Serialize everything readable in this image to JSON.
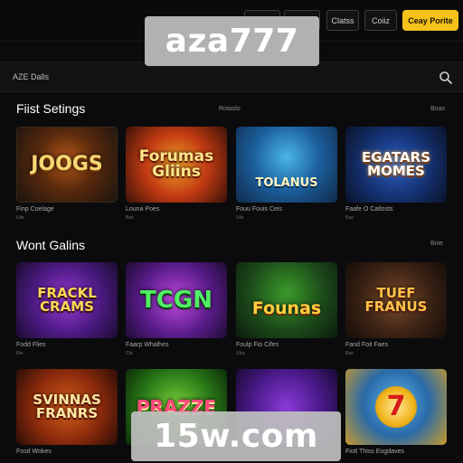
{
  "header": {
    "buttons": [
      {
        "label": ""
      },
      {
        "label": ""
      },
      {
        "label": "Clatss"
      },
      {
        "label": "Coiiz"
      },
      {
        "label": "Ceay Porite"
      }
    ]
  },
  "search": {
    "label": "AZE Dalls",
    "icon": "search-icon"
  },
  "sections": [
    {
      "title": "Fiist Setings",
      "mid_label": "Rotaslo",
      "right_label": "Boas",
      "tiles": [
        {
          "text": "JOOGS",
          "caption": "Finp Coelage",
          "subcaption": "Ulte"
        },
        {
          "text": "Forumas Gliins",
          "caption": "Louna Poes",
          "subcaption": "Bas"
        },
        {
          "text": "TOLANUS",
          "caption": "Fouu Fouis Ceis",
          "subcaption": "Ulis"
        },
        {
          "text": "EGATARS MOMES",
          "caption": "Faafe O Catlosts",
          "subcaption": "Bao"
        }
      ]
    },
    {
      "title": "Wont Galins",
      "mid_label": "",
      "right_label": "Bnie",
      "tiles": [
        {
          "text": "FRACKL CRAMS",
          "caption": "Fodd Flies",
          "subcaption": "Ilile"
        },
        {
          "text": "TCGN",
          "caption": "Faarp Whalhes",
          "subcaption": "Cte"
        },
        {
          "text": "Founas",
          "caption": "Foulp Fio Cifes",
          "subcaption": "Ulos"
        },
        {
          "text": "TUEF FRANUS",
          "caption": "Fand Foit Faes",
          "subcaption": "Bao"
        }
      ]
    },
    {
      "tiles": [
        {
          "text": "SVINNAS FRANRS",
          "caption": "Fosd Wokes",
          "subcaption": ""
        },
        {
          "text": "PRAZZE",
          "caption": "",
          "subcaption": ""
        },
        {
          "text": "",
          "caption": "",
          "subcaption": ""
        },
        {
          "text": "7",
          "caption": "Fiotl Thiss Eogdaves",
          "subcaption": ""
        }
      ]
    }
  ],
  "watermarks": {
    "top": "aza777",
    "bottom": "15w.com"
  },
  "colors": {
    "accent": "#f5c21b",
    "background": "#0b0b0d"
  }
}
